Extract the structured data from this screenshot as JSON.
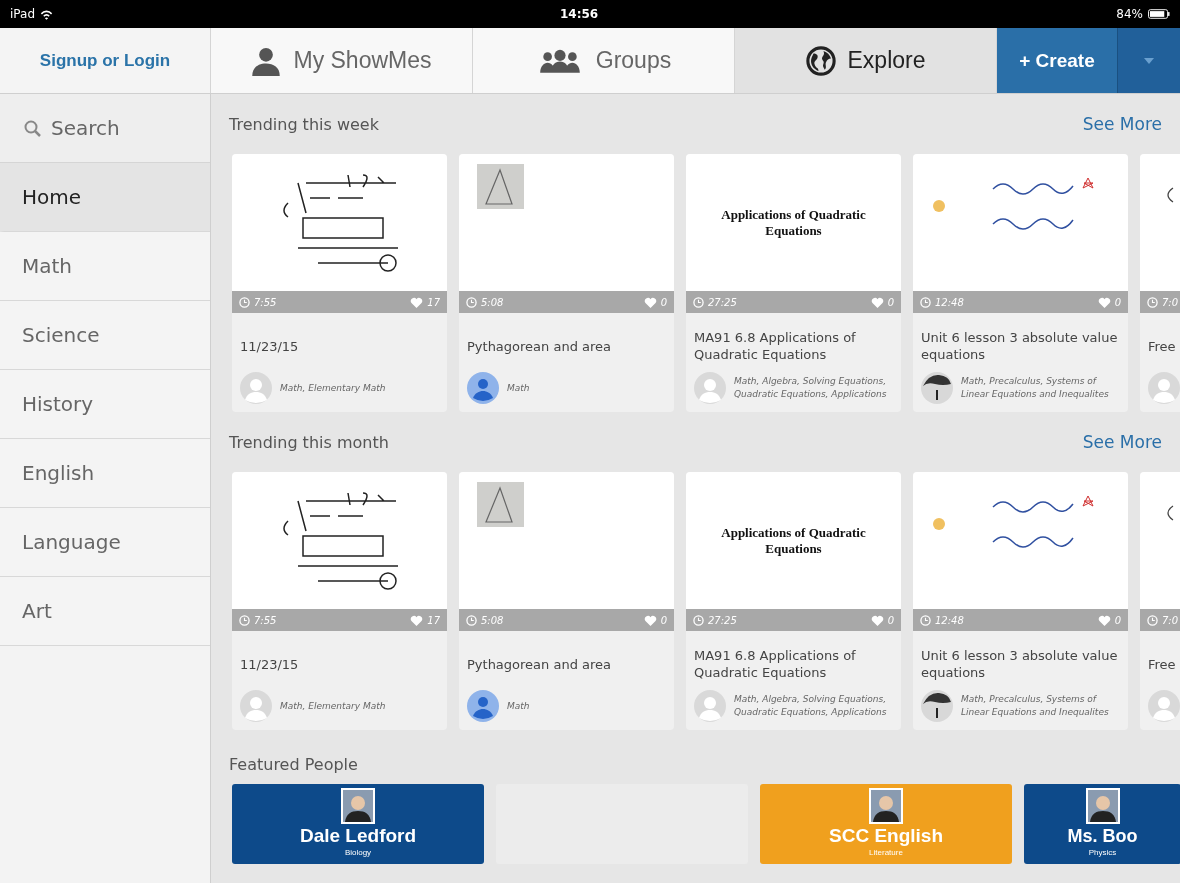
{
  "status_bar": {
    "device": "iPad",
    "time": "14:56",
    "battery": "84%"
  },
  "nav": {
    "login": "Signup or Login",
    "tabs": [
      {
        "label": "My ShowMes",
        "kind": "person",
        "selected": false
      },
      {
        "label": "Groups",
        "kind": "group",
        "selected": false
      },
      {
        "label": "Explore",
        "kind": "globe",
        "selected": true
      }
    ],
    "create": "+ Create"
  },
  "sidebar": {
    "search": "Search",
    "items": [
      {
        "label": "Home",
        "selected": true
      },
      {
        "label": "Math",
        "selected": false
      },
      {
        "label": "Science",
        "selected": false
      },
      {
        "label": "History",
        "selected": false
      },
      {
        "label": "English",
        "selected": false
      },
      {
        "label": "Language",
        "selected": false
      },
      {
        "label": "Art",
        "selected": false
      }
    ]
  },
  "sections": [
    {
      "title": "Trending this week",
      "more": "See More",
      "cards": [
        {
          "duration": "7:55",
          "likes": "17",
          "title": "11/23/15",
          "tags": "Math, Elementary Math"
        },
        {
          "duration": "5:08",
          "likes": "0",
          "title": "Pythagorean and area",
          "tags": "Math"
        },
        {
          "thumbnail": {
            "kind": "slide",
            "text": "Applications of Quadratic Equations"
          },
          "duration": "27:25",
          "likes": "0",
          "title": "MA91 6.8 Applications of Quadratic Equations",
          "tags": "Math, Algebra, Solving Equations, Quadratic Equations, Applications"
        },
        {
          "duration": "12:48",
          "likes": "0",
          "title": "Unit 6 lesson 3 absolute value equations",
          "tags": "Math, Precalculus, Systems of Linear Equations and Inequalites"
        },
        {
          "duration": "7:0",
          "title": "Free"
        }
      ]
    },
    {
      "title": "Trending this month",
      "more": "See More",
      "cards": [
        {
          "duration": "7:55",
          "likes": "17",
          "title": "11/23/15",
          "tags": "Math, Elementary Math"
        },
        {
          "duration": "5:08",
          "likes": "0",
          "title": "Pythagorean and area",
          "tags": "Math"
        },
        {
          "thumbnail": {
            "kind": "slide",
            "text": "Applications of Quadratic Equations"
          },
          "duration": "27:25",
          "likes": "0",
          "title": "MA91 6.8 Applications of Quadratic Equations",
          "tags": "Math, Algebra, Solving Equations, Quadratic Equations, Applications"
        },
        {
          "duration": "12:48",
          "likes": "0",
          "title": "Unit 6 lesson 3 absolute value equations",
          "tags": "Math, Precalculus, Systems of Linear Equations and Inequalites"
        },
        {
          "duration": "7:0",
          "title": "Free"
        }
      ]
    }
  ],
  "featured": {
    "title": "Featured People",
    "people": [
      {
        "kind": "person",
        "name": "Dale Ledford",
        "subject": "Biology",
        "color": "#0d4a8a"
      },
      {
        "kind": "empty"
      },
      {
        "kind": "person",
        "name": "SCC English",
        "subject": "Literature",
        "color": "#f0a01e"
      },
      {
        "kind": "person",
        "name": "Ms. Boo",
        "subject": "Physics",
        "color": "#0d4a8a"
      }
    ]
  }
}
